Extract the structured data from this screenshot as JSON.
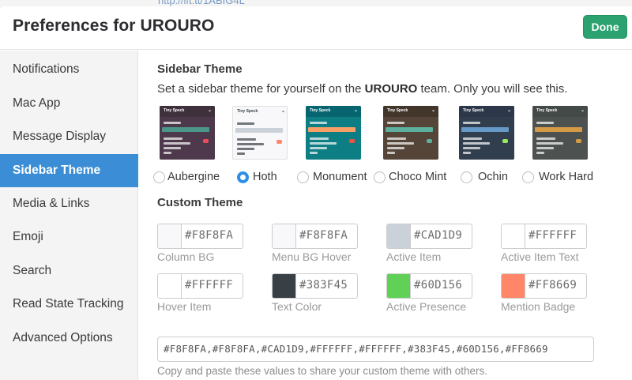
{
  "background_link": "http://ift.tt/1ABIG4L",
  "header": {
    "title": "Preferences for UROURO",
    "done_label": "Done"
  },
  "sidebar": {
    "items": [
      {
        "label": "Notifications"
      },
      {
        "label": "Mac App"
      },
      {
        "label": "Message Display"
      },
      {
        "label": "Sidebar Theme",
        "active": true
      },
      {
        "label": "Media & Links"
      },
      {
        "label": "Emoji"
      },
      {
        "label": "Search"
      },
      {
        "label": "Read State Tracking"
      },
      {
        "label": "Advanced Options"
      }
    ]
  },
  "sidebar_theme": {
    "title": "Sidebar Theme",
    "desc_before": "Set a sidebar theme for yourself on the ",
    "desc_team": "UROURO",
    "desc_after": " team. Only you will see this.",
    "preview_header": "Tiny Speck",
    "preview_items": [
      "STARRED",
      "features",
      "general",
      "marketing",
      "mobile",
      "ui"
    ],
    "themes": [
      {
        "name": "Aubergine",
        "selected": false,
        "colors": {
          "bg": "#4d394b",
          "header": "#3e313c",
          "text": "#ffffff",
          "active": "#4c9689",
          "badge": "#eb4d5c"
        }
      },
      {
        "name": "Hoth",
        "selected": true,
        "colors": {
          "bg": "#f8f8fa",
          "header": "#f8f8fa",
          "text": "#383f45",
          "active": "#cad1d9",
          "badge": "#ff8669"
        }
      },
      {
        "name": "Monument",
        "selected": false,
        "colors": {
          "bg": "#0d7e83",
          "header": "#076570",
          "text": "#ffffff",
          "active": "#f79f66",
          "badge": "#f15340"
        }
      },
      {
        "name": "Choco Mint",
        "selected": false,
        "colors": {
          "bg": "#544538",
          "header": "#42362b",
          "text": "#ffffff",
          "active": "#5db09d",
          "badge": "#5db09d"
        }
      },
      {
        "name": "Ochin",
        "selected": false,
        "colors": {
          "bg": "#303e4d",
          "header": "#2c3849",
          "text": "#ffffff",
          "active": "#6698c8",
          "badge": "#94e864"
        }
      },
      {
        "name": "Work Hard",
        "selected": false,
        "colors": {
          "bg": "#4d5250",
          "header": "#444a47",
          "text": "#ffffff",
          "active": "#d39b46",
          "badge": "#d39b46"
        }
      }
    ]
  },
  "custom_theme": {
    "title": "Custom Theme",
    "swatches": [
      {
        "label": "Column BG",
        "hex": "#F8F8FA"
      },
      {
        "label": "Menu BG Hover",
        "hex": "#F8F8FA"
      },
      {
        "label": "Active Item",
        "hex": "#CAD1D9"
      },
      {
        "label": "Active Item Text",
        "hex": "#FFFFFF"
      },
      {
        "label": "Hover Item",
        "hex": "#FFFFFF"
      },
      {
        "label": "Text Color",
        "hex": "#383F45"
      },
      {
        "label": "Active Presence",
        "hex": "#60D156"
      },
      {
        "label": "Mention Badge",
        "hex": "#FF8669"
      }
    ],
    "paste_value": "#F8F8FA,#F8F8FA,#CAD1D9,#FFFFFF,#FFFFFF,#383F45,#60D156,#FF8669",
    "paste_hint": "Copy and paste these values to share your custom theme with others."
  }
}
